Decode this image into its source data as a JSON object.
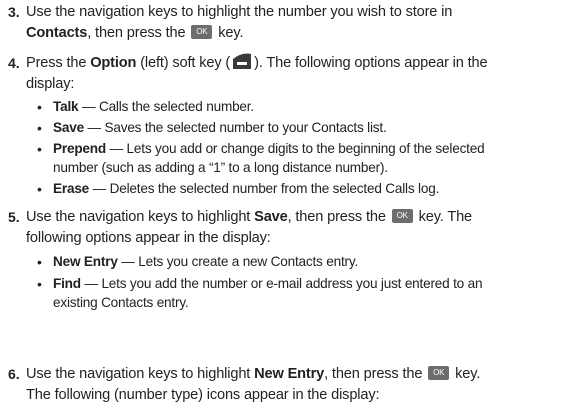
{
  "steps": [
    {
      "num": "3.",
      "a": "Use the navigation keys to highlight the number you wish to store in",
      "b_bold": "Contacts",
      "b_mid": ", then press the",
      "b_end": "key."
    },
    {
      "num": "4.",
      "a_pre": "Press the",
      "a_bold": "Option",
      "a_mid": "(left) soft key (",
      "a_end": "). The following options appear in the",
      "b": "display:",
      "bullets": [
        {
          "term": "Talk",
          "desc": "— Calls the selected number."
        },
        {
          "term": "Save",
          "desc": "— Saves the selected number to your Contacts list."
        },
        {
          "term": "Prepend",
          "desc": "— Lets you add or change digits to the beginning of the selected",
          "desc2": "number (such as adding a “1” to a long distance number)."
        },
        {
          "term": "Erase",
          "desc": "— Deletes the selected number from the selected Calls log."
        }
      ]
    },
    {
      "num": "5.",
      "a_pre": "Use the navigation keys to highlight",
      "a_bold": "Save",
      "a_mid": ", then press the",
      "a_end": "key. The",
      "b": "following options appear in the display:",
      "bullets": [
        {
          "term": "New Entry",
          "desc": "— Lets you create a new Contacts entry."
        },
        {
          "term": "Find",
          "desc": "— Lets you add the number or e-mail address you just entered to an",
          "desc2": "existing Contacts entry."
        }
      ]
    },
    {
      "num": "6.",
      "a_pre": "Use the navigation keys to highlight",
      "a_bold": "New Entry",
      "a_mid": ", then press the",
      "a_end": "key.",
      "b": "The following (number type) icons appear in the display:"
    }
  ],
  "ok_label": "OK",
  "icons": {
    "ok": "ok-key-icon",
    "softkey": "left-soft-key-icon"
  },
  "colors": {
    "ok_bg": "#6d6d6d",
    "text": "#222222"
  }
}
